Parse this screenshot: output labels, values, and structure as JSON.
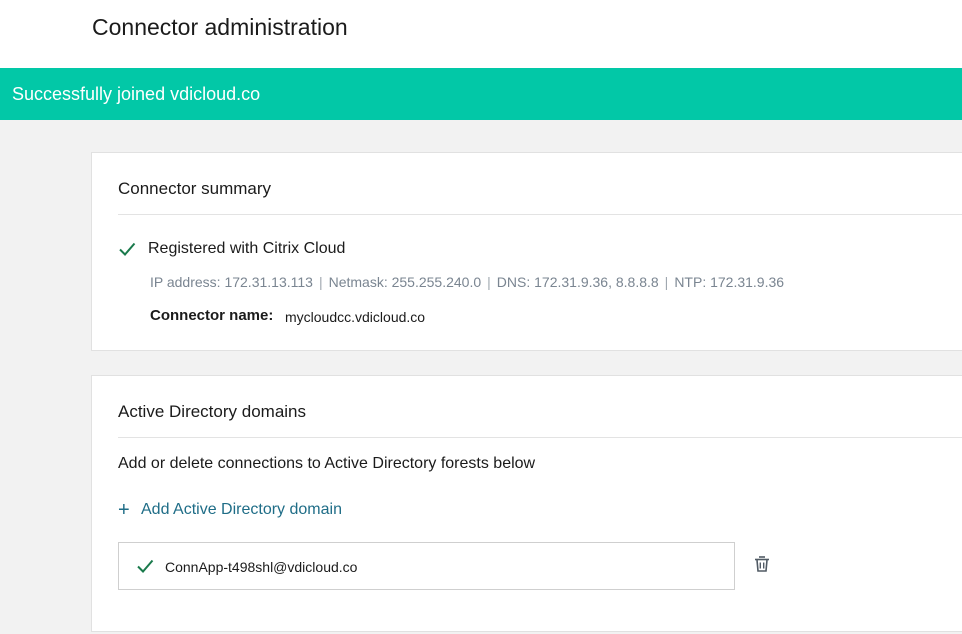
{
  "header": {
    "title": "Connector administration"
  },
  "banner": {
    "message": "Successfully joined vdicloud.co",
    "color": "#02c8a7"
  },
  "summary": {
    "title": "Connector summary",
    "status_icon": "checkmark-icon",
    "status": "Registered with Citrix Cloud",
    "network": {
      "ip": "IP address: 172.31.13.113",
      "netmask": "Netmask: 255.255.240.0",
      "dns": "DNS: 172.31.9.36, 8.8.8.8",
      "ntp": "NTP: 172.31.9.36",
      "separator": "|"
    },
    "connector_name_label": "Connector name:",
    "connector_name_value": "mycloudcc.vdicloud.co"
  },
  "ad": {
    "title": "Active Directory domains",
    "description": "Add or delete connections to Active Directory forests below",
    "add_label": "Add Active Directory domain",
    "add_icon": "plus-icon",
    "domains": [
      {
        "name": "ConnApp-t498shl@vdicloud.co",
        "status_icon": "checkmark-icon",
        "delete_icon": "trash-icon"
      }
    ]
  },
  "colors": {
    "accent": "#02c8a7",
    "check": "#1a7a4c",
    "link": "#1f6d87",
    "muted_text": "#7a8591"
  }
}
